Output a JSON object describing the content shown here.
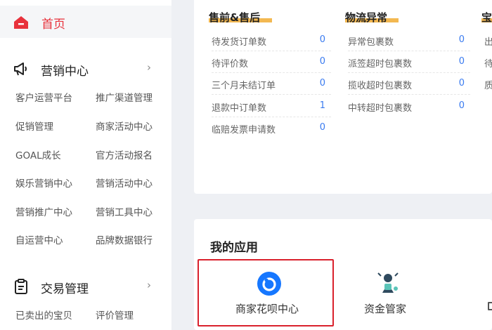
{
  "sidebar": {
    "home": {
      "label": "首页"
    },
    "marketing": {
      "title": "营销中心",
      "items": [
        "客户运营平台",
        "推广渠道管理",
        "促销管理",
        "商家活动中心",
        "GOAL成长",
        "官方活动报名",
        "娱乐营销中心",
        "营销活动中心",
        "营销推广中心",
        "营销工具中心",
        "自运营中心",
        "品牌数据银行"
      ]
    },
    "trade": {
      "title": "交易管理",
      "items": [
        "已卖出的宝贝",
        "评价管理"
      ]
    }
  },
  "cards": {
    "presale": {
      "title": "售前&售后",
      "rows": [
        {
          "name": "待发货订单数",
          "value": "0"
        },
        {
          "name": "待评价数",
          "value": "0"
        },
        {
          "name": "三个月未结订单",
          "value": "0"
        },
        {
          "name": "退款中订单数",
          "value": "1"
        },
        {
          "name": "临赔发票申请数",
          "value": "0"
        }
      ]
    },
    "logistics": {
      "title": "物流异常",
      "rows": [
        {
          "name": "异常包裹数",
          "value": "0"
        },
        {
          "name": "派签超时包裹数",
          "value": "0"
        },
        {
          "name": "揽收超时包裹数",
          "value": "0"
        },
        {
          "name": "中转超时包裹数",
          "value": "0"
        }
      ]
    },
    "third": {
      "title": "宝",
      "rows": [
        "出",
        "待",
        "质"
      ]
    }
  },
  "apps": {
    "title": "我的应用",
    "items": [
      {
        "label": "商家花呗中心"
      },
      {
        "label": "资金管家"
      }
    ]
  },
  "colors": {
    "accent": "#e8323c",
    "value_blue": "#3a7bf0",
    "highlight_box": "#d9212c",
    "title_underline": "#f2b03e"
  }
}
